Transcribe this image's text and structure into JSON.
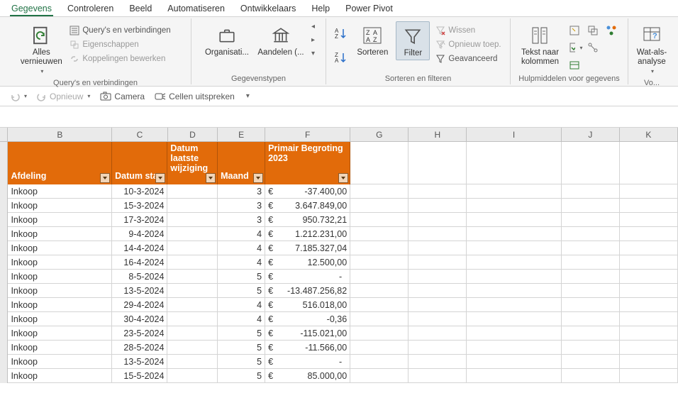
{
  "tabs": [
    "Gegevens",
    "Controleren",
    "Beeld",
    "Automatiseren",
    "Ontwikkelaars",
    "Help",
    "Power Pivot"
  ],
  "active_tab": 0,
  "ribbon": {
    "group_queries": {
      "label": "Query's en verbindingen",
      "refresh_all": "Alles vernieuwen",
      "queries_conn": "Query's en verbindingen",
      "properties": "Eigenschappen",
      "edit_links": "Koppelingen bewerken"
    },
    "group_datatypes": {
      "label": "Gegevenstypen",
      "org": "Organisati...",
      "stocks": "Aandelen (..."
    },
    "group_sortfilter": {
      "label": "Sorteren en filteren",
      "sort": "Sorteren",
      "filter": "Filter",
      "clear": "Wissen",
      "reapply": "Opnieuw toep.",
      "advanced": "Geavanceerd"
    },
    "group_datatools": {
      "label": "Hulpmiddelen voor gegevens",
      "text_to_cols": "Tekst naar kolommen"
    },
    "group_whatif": {
      "label_part": "Vo...",
      "whatif": "Wat-als-analyse"
    }
  },
  "qat": {
    "redo": "Opnieuw",
    "camera": "Camera",
    "speak": "Cellen uitspreken"
  },
  "columns": [
    "B",
    "C",
    "D",
    "E",
    "F",
    "G",
    "H",
    "I",
    "J",
    "K"
  ],
  "table_headers": {
    "B": "Afdeling",
    "C": "Datum sta",
    "D": "Datum laatste wijziging",
    "E": "Maand",
    "F": "Primair Begroting 2023"
  },
  "rows": [
    {
      "afd": "Inkoop",
      "dat": "10-3-2024",
      "wij": "",
      "mnd": "3",
      "bed": "-37.400,00"
    },
    {
      "afd": "Inkoop",
      "dat": "15-3-2024",
      "wij": "",
      "mnd": "3",
      "bed": "3.647.849,00"
    },
    {
      "afd": "Inkoop",
      "dat": "17-3-2024",
      "wij": "",
      "mnd": "3",
      "bed": "950.732,21"
    },
    {
      "afd": "Inkoop",
      "dat": "9-4-2024",
      "wij": "",
      "mnd": "4",
      "bed": "1.212.231,00"
    },
    {
      "afd": "Inkoop",
      "dat": "14-4-2024",
      "wij": "",
      "mnd": "4",
      "bed": "7.185.327,04"
    },
    {
      "afd": "Inkoop",
      "dat": "16-4-2024",
      "wij": "",
      "mnd": "4",
      "bed": "12.500,00"
    },
    {
      "afd": "Inkoop",
      "dat": "8-5-2024",
      "wij": "",
      "mnd": "5",
      "bed": "-"
    },
    {
      "afd": "Inkoop",
      "dat": "13-5-2024",
      "wij": "",
      "mnd": "5",
      "bed": "-13.487.256,82"
    },
    {
      "afd": "Inkoop",
      "dat": "29-4-2024",
      "wij": "",
      "mnd": "4",
      "bed": "516.018,00"
    },
    {
      "afd": "Inkoop",
      "dat": "30-4-2024",
      "wij": "",
      "mnd": "4",
      "bed": "-0,36"
    },
    {
      "afd": "Inkoop",
      "dat": "23-5-2024",
      "wij": "",
      "mnd": "5",
      "bed": "-115.021,00"
    },
    {
      "afd": "Inkoop",
      "dat": "28-5-2024",
      "wij": "",
      "mnd": "5",
      "bed": "-11.566,00"
    },
    {
      "afd": "Inkoop",
      "dat": "13-5-2024",
      "wij": "",
      "mnd": "5",
      "bed": "-"
    },
    {
      "afd": "Inkoop",
      "dat": "15-5-2024",
      "wij": "",
      "mnd": "5",
      "bed": "85.000,00"
    }
  ],
  "currency_symbol": "€"
}
